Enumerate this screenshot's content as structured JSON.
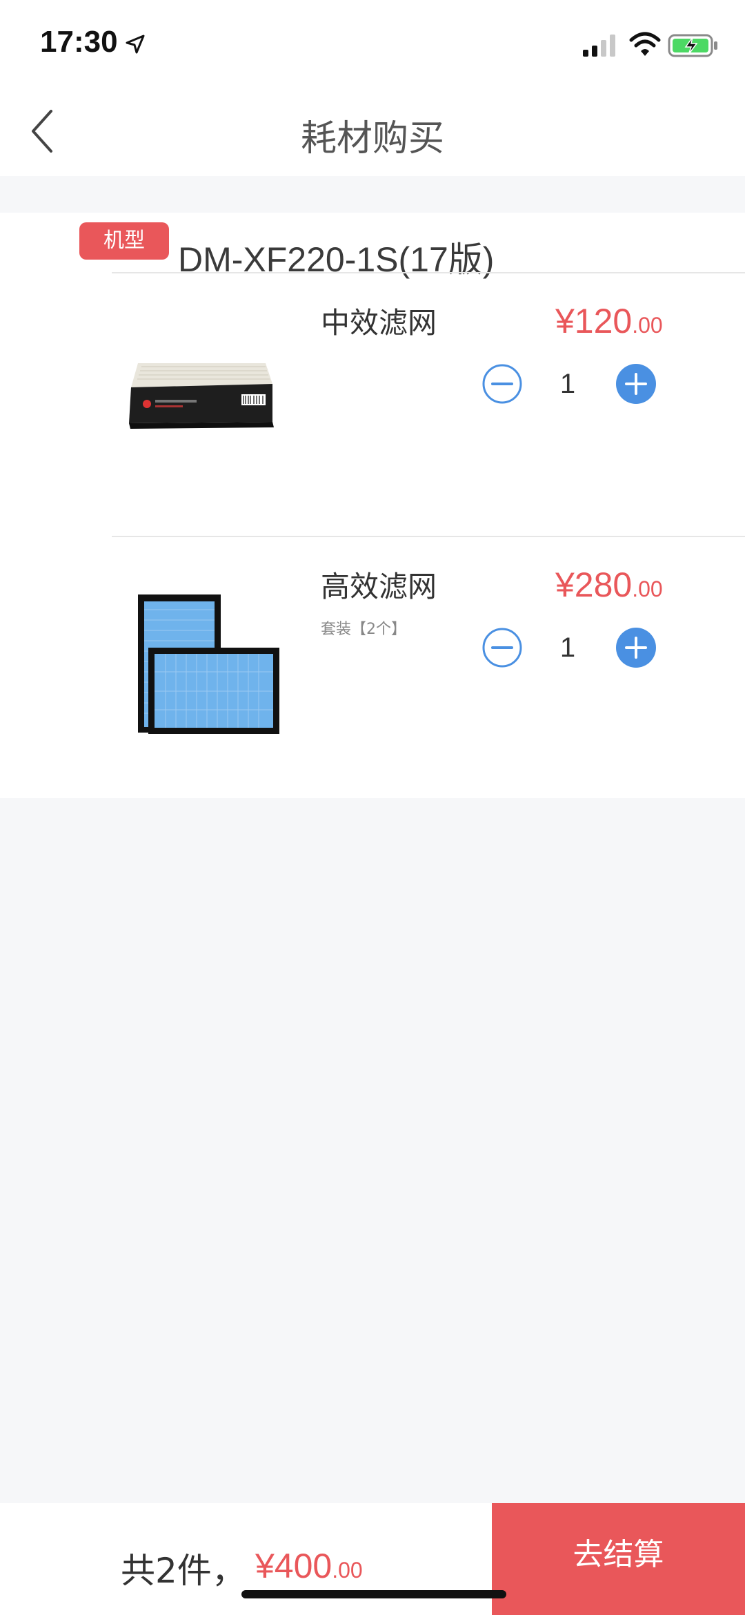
{
  "status_bar": {
    "time": "17:30",
    "icons": [
      "location-arrow-icon",
      "signal-icon",
      "wifi-icon",
      "battery-charging-icon"
    ]
  },
  "nav": {
    "title": "耗材购买",
    "back_icon": "chevron-left-icon"
  },
  "model": {
    "badge": "机型",
    "name": "DM-XF220-1S(17版)"
  },
  "items": [
    {
      "name": "中效滤网",
      "subtitle": "",
      "price_main": "¥120",
      "price_decimal": ".00",
      "quantity": "1",
      "image": "black-frame-hepa-filter-image"
    },
    {
      "name": "高效滤网",
      "subtitle": "套装【2个】",
      "price_main": "¥280",
      "price_decimal": ".00",
      "quantity": "1",
      "image": "blue-filter-pair-image"
    }
  ],
  "footer": {
    "count_text": "共2件，",
    "total_main": "¥400",
    "total_decimal": ".00",
    "checkout_label": "去结算"
  },
  "colors": {
    "accent_red": "#e9575a",
    "stepper_blue": "#4a90e2",
    "background": "#f6f7f9"
  }
}
